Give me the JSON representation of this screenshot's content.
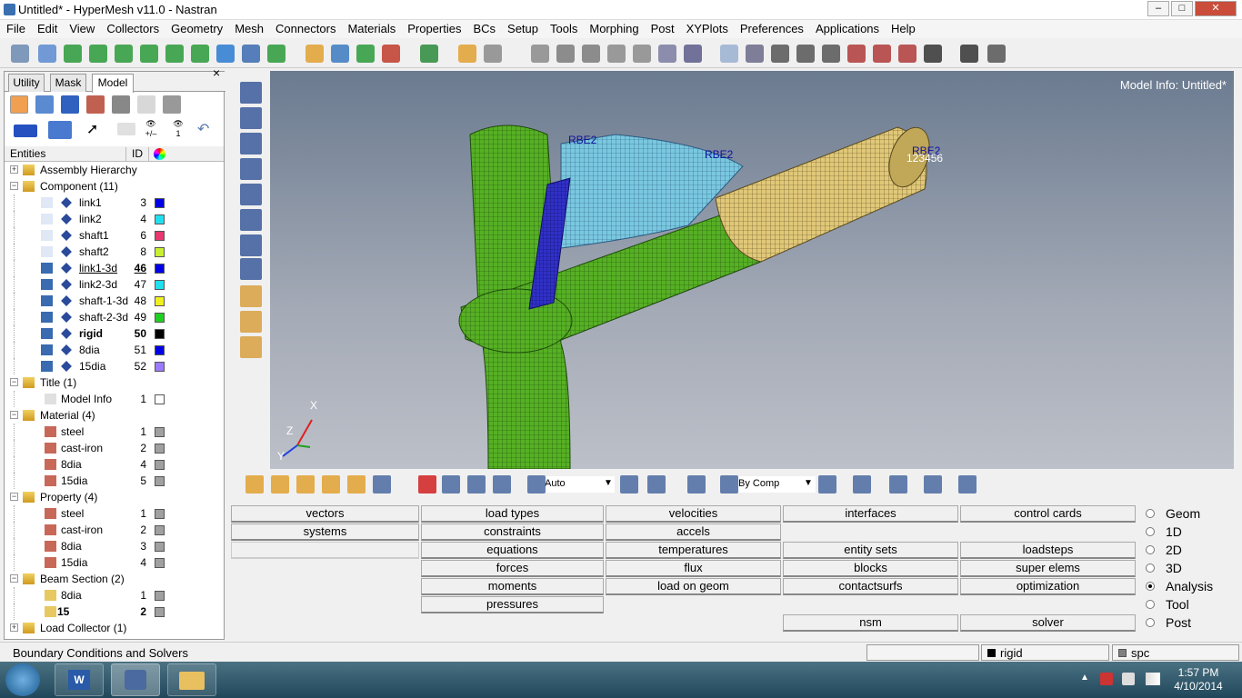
{
  "window": {
    "title": "Untitled* - HyperMesh v11.0 - Nastran",
    "minimize": "–",
    "maximize": "□",
    "close": "✕"
  },
  "menu": [
    "File",
    "Edit",
    "View",
    "Collectors",
    "Geometry",
    "Mesh",
    "Connectors",
    "Materials",
    "Properties",
    "BCs",
    "Setup",
    "Tools",
    "Morphing",
    "Post",
    "XYPlots",
    "Preferences",
    "Applications",
    "Help"
  ],
  "panel": {
    "tabs": [
      "Utility",
      "Mask",
      "Model"
    ],
    "active_tab": "Model",
    "close": "×",
    "columns": {
      "entities": "Entities",
      "id": "ID"
    },
    "eye_labels": [
      "+/–",
      "1"
    ]
  },
  "tree": [
    {
      "type": "group",
      "label": "Assembly Hierarchy",
      "expanded": false,
      "icon": "assembly-icon"
    },
    {
      "type": "group",
      "label": "Component (11)",
      "expanded": true,
      "icon": "component-icon"
    },
    {
      "type": "item",
      "label": "link1",
      "id": "3",
      "color": "#0000e6",
      "state": "hidden"
    },
    {
      "type": "item",
      "label": "link2",
      "id": "4",
      "color": "#20e0f0",
      "state": "hidden"
    },
    {
      "type": "item",
      "label": "shaft1",
      "id": "6",
      "color": "#e83870",
      "state": "hidden"
    },
    {
      "type": "item",
      "label": "shaft2",
      "id": "8",
      "color": "#c8f030",
      "state": "hidden"
    },
    {
      "type": "item",
      "label": "link1-3d",
      "id": "46",
      "color": "#0000e6",
      "state": "current"
    },
    {
      "type": "item",
      "label": "link2-3d",
      "id": "47",
      "color": "#20e0f0",
      "state": "shown"
    },
    {
      "type": "item",
      "label": "shaft-1-3d",
      "id": "48",
      "color": "#f0f020",
      "state": "shown"
    },
    {
      "type": "item",
      "label": "shaft-2-3d",
      "id": "49",
      "color": "#20d020",
      "state": "shown"
    },
    {
      "type": "item",
      "label": "rigid",
      "id": "50",
      "color": "#000000",
      "state": "bold"
    },
    {
      "type": "item",
      "label": "8dia",
      "id": "51",
      "color": "#0000e6",
      "state": "shown"
    },
    {
      "type": "item",
      "label": "15dia",
      "id": "52",
      "color": "#9a7aff",
      "state": "shown"
    },
    {
      "type": "group",
      "label": "Title (1)",
      "expanded": true,
      "icon": "title-icon"
    },
    {
      "type": "item",
      "label": "Model Info",
      "id": "1",
      "color": "#ffffff",
      "state": "title"
    },
    {
      "type": "group",
      "label": "Material (4)",
      "expanded": true,
      "icon": "material-icon"
    },
    {
      "type": "item",
      "label": "steel",
      "id": "1",
      "color": "#a0a0a0",
      "state": "mat"
    },
    {
      "type": "item",
      "label": "cast-iron",
      "id": "2",
      "color": "#a0a0a0",
      "state": "mat"
    },
    {
      "type": "item",
      "label": "8dia",
      "id": "4",
      "color": "#a0a0a0",
      "state": "mat"
    },
    {
      "type": "item",
      "label": "15dia",
      "id": "5",
      "color": "#a0a0a0",
      "state": "mat"
    },
    {
      "type": "group",
      "label": "Property (4)",
      "expanded": true,
      "icon": "property-icon"
    },
    {
      "type": "item",
      "label": "steel",
      "id": "1",
      "color": "#a0a0a0",
      "state": "prop"
    },
    {
      "type": "item",
      "label": "cast-iron",
      "id": "2",
      "color": "#a0a0a0",
      "state": "prop"
    },
    {
      "type": "item",
      "label": "8dia",
      "id": "3",
      "color": "#a0a0a0",
      "state": "prop"
    },
    {
      "type": "item",
      "label": "15dia",
      "id": "4",
      "color": "#a0a0a0",
      "state": "prop"
    },
    {
      "type": "group",
      "label": "Beam Section (2)",
      "expanded": true,
      "icon": "beam-section-icon"
    },
    {
      "type": "item",
      "label": "8dia",
      "id": "1",
      "color": "#a0a0a0",
      "state": "beam"
    },
    {
      "type": "item",
      "label": "15",
      "id": "2",
      "color": "#a0a0a0",
      "state": "beambold"
    },
    {
      "type": "group",
      "label": "Load Collector (1)",
      "expanded": false,
      "icon": "load-collector-icon"
    }
  ],
  "viewport": {
    "model_info": "Model Info: Untitled*",
    "labels": [
      "RBE2",
      "RBE2",
      "RBE2",
      "123456"
    ],
    "axes": [
      "X",
      "Y",
      "Z"
    ]
  },
  "bottom_toolbar": {
    "vis_mode": "Auto",
    "color_mode": "By Comp"
  },
  "buttons": {
    "col1": [
      "vectors",
      "systems"
    ],
    "col2": [
      "load types",
      "constraints",
      "equations",
      "forces",
      "moments",
      "pressures"
    ],
    "col3": [
      "velocities",
      "accels",
      "temperatures",
      "flux",
      "load on geom"
    ],
    "col4": [
      "interfaces",
      "entity sets",
      "blocks",
      "contactsurfs",
      "nsm"
    ],
    "col5": [
      "control cards",
      "loadsteps",
      "super elems",
      "optimization",
      "solver"
    ]
  },
  "radios": [
    {
      "label": "Geom",
      "checked": false
    },
    {
      "label": "1D",
      "checked": false
    },
    {
      "label": "2D",
      "checked": false
    },
    {
      "label": "3D",
      "checked": false
    },
    {
      "label": "Analysis",
      "checked": true
    },
    {
      "label": "Tool",
      "checked": false
    },
    {
      "label": "Post",
      "checked": false
    }
  ],
  "status": {
    "text": "Boundary Conditions and Solvers",
    "component": "rigid",
    "loadcol": "spc"
  },
  "taskbar": {
    "time": "1:57 PM",
    "date": "4/10/2014"
  },
  "colors": {
    "selected_comp": "#000000",
    "spc": "#808080"
  }
}
